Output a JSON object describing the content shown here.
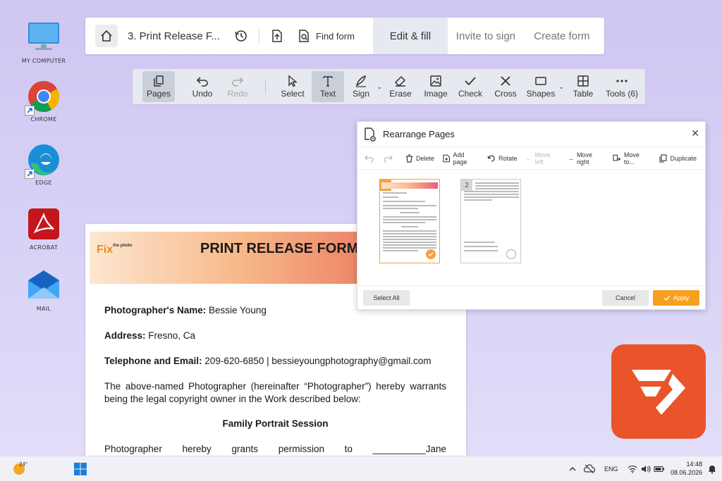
{
  "desktop": {
    "icons": [
      {
        "label": "MY COMPUTER"
      },
      {
        "label": "CHROME"
      },
      {
        "label": "EDGE"
      },
      {
        "label": "ACROBAT"
      },
      {
        "label": "MAIL"
      }
    ]
  },
  "topbar": {
    "doc_title": "3. Print Release F...",
    "find_form": "Find form",
    "tabs": [
      {
        "label": "Edit & fill",
        "active": true
      },
      {
        "label": "Invite to sign",
        "active": false
      },
      {
        "label": "Create form",
        "active": false
      }
    ]
  },
  "toolbar": {
    "tools": [
      {
        "label": "Pages"
      },
      {
        "label": "Undo"
      },
      {
        "label": "Redo"
      },
      {
        "label": "Select"
      },
      {
        "label": "Text"
      },
      {
        "label": "Sign"
      },
      {
        "label": "Erase"
      },
      {
        "label": "Image"
      },
      {
        "label": "Check"
      },
      {
        "label": "Cross"
      },
      {
        "label": "Shapes"
      },
      {
        "label": "Table"
      },
      {
        "label": "Tools (6)"
      }
    ]
  },
  "rearrange": {
    "title": "Rearrange Pages",
    "actions": [
      "Delete",
      "Add page",
      "Rotate",
      "Move left",
      "Move right",
      "Move to...",
      "Duplicate"
    ],
    "pages": [
      "1",
      "2"
    ],
    "select_all": "Select All",
    "cancel": "Cancel",
    "apply": "Apply"
  },
  "document": {
    "logo": "Fix",
    "logo_small": "the photo",
    "heading": "PRINT RELEASE FORM",
    "name_label": "Photographer's Name:",
    "name_value": "Bessie Young",
    "address_label": "Address:",
    "address_value": "Fresno, Ca",
    "phone_label": "Telephone and Email:",
    "phone_value": "209-620-6850 | bessieyoungphotography@gmail.com",
    "para1": "The above-named Photographer (hereinafter “Photographer”) hereby warrants being the legal copyright owner in the Work described below:",
    "session": "Family Portrait Session",
    "para2": "Photographer hereby grants permission to __________Jane Doe_____________ and his/her/their/its (‘hereinafter “Grantee”) Photo Laboratory of choice to make reproductions of the Work from the Photography Session/s described above in"
  },
  "taskbar": {
    "temp": "24°",
    "lang": "ENG",
    "time": "14:48",
    "date": "08.06.2026"
  },
  "colors": {
    "accent": "#f7a01e",
    "brand": "#e9542a"
  }
}
